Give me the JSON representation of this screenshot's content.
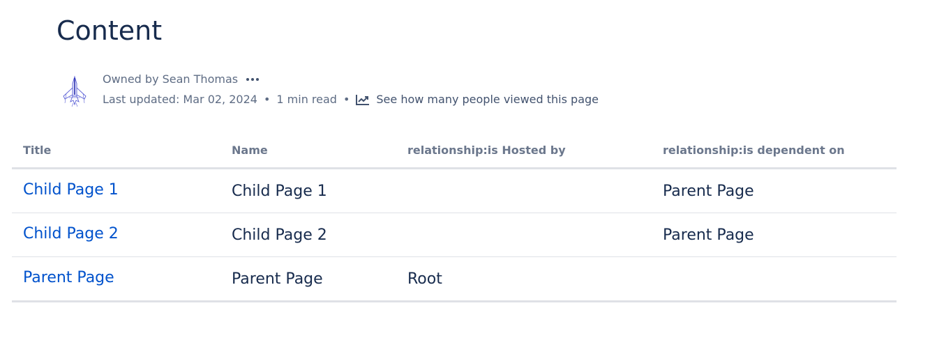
{
  "page": {
    "title": "Content"
  },
  "byline": {
    "owner_text": "Owned by Sean Thomas",
    "last_updated": "Last updated: Mar 02, 2024",
    "read_time": "1 min read",
    "separator": "•",
    "views_link": "See how many people viewed this page",
    "more_icon": "more-horizontal-icon",
    "chart_icon": "line-chart-icon",
    "avatar_icon": "spaceship-avatar"
  },
  "table": {
    "headers": [
      "Title",
      "Name",
      "relationship:is Hosted by",
      "relationship:is dependent on"
    ],
    "rows": [
      [
        "Child Page 1",
        "Child Page 1",
        "",
        "Parent Page"
      ],
      [
        "Child Page 2",
        "Child Page 2",
        "",
        "Parent Page"
      ],
      [
        "Parent Page",
        "Parent Page",
        "Root",
        ""
      ]
    ]
  },
  "colors": {
    "title_text": "#172b4d",
    "link": "#0052cc",
    "muted": "#5e6c84",
    "header_text": "#6b778c",
    "border": "#dfe1e6"
  }
}
